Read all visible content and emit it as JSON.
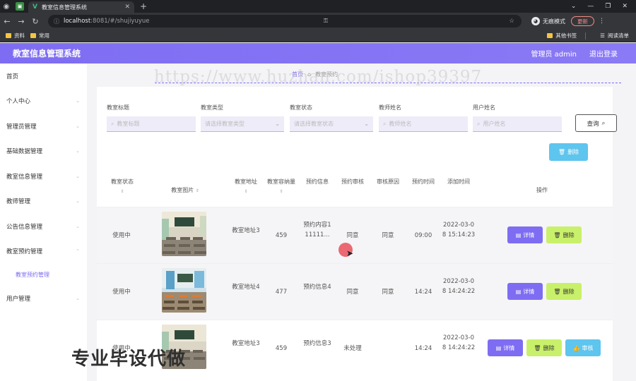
{
  "browser": {
    "tab_title": "教室信息管理系统",
    "url_host": "localhost",
    "url_path": ":8081/#/shujiyuyue",
    "incognito_label": "无痕模式",
    "update_label": "更新",
    "bookmarks": [
      "资料",
      "常用"
    ],
    "bookmarks_right": [
      "其他书签",
      "阅读清单"
    ]
  },
  "header": {
    "title": "教室信息管理系统",
    "user": "管理员 admin",
    "logout": "退出登录"
  },
  "sidebar": {
    "items": [
      {
        "label": "首页"
      },
      {
        "label": "个人中心"
      },
      {
        "label": "管理员管理"
      },
      {
        "label": "基础数据管理"
      },
      {
        "label": "教室信息管理"
      },
      {
        "label": "教师管理"
      },
      {
        "label": "公告信息管理"
      },
      {
        "label": "教室预约管理"
      }
    ],
    "active_sub": "教室预约管理",
    "last_item": "用户管理"
  },
  "breadcrumb": {
    "home": "首页",
    "current": "教室预约"
  },
  "filters": {
    "labels": [
      "教室标题",
      "教室类型",
      "教室状态",
      "教师姓名",
      "用户姓名"
    ],
    "placeholders": [
      "教室标题",
      "请选择教室类型",
      "请选择教室状态",
      "教师姓名",
      "用户姓名"
    ],
    "query_button": "查询"
  },
  "toolbar": {
    "delete_label": "删除"
  },
  "table": {
    "headers": [
      "教室状态",
      "教室图片",
      "教室地址",
      "教室容纳量",
      "预约信息",
      "预约审核",
      "审核原因",
      "预约时间",
      "添加时间",
      "操作"
    ],
    "rows": [
      {
        "status": "使用中",
        "address": "教室地址3",
        "capacity": "459",
        "info": "预约内容111111...",
        "audit": "同意",
        "reason": "同意",
        "time": "09:00",
        "added": "2022-03-08 15:14:23"
      },
      {
        "status": "使用中",
        "address": "教室地址4",
        "capacity": "477",
        "info": "预约信息4",
        "audit": "同意",
        "reason": "同意",
        "time": "14:24",
        "added": "2022-03-08 14:24:22"
      },
      {
        "status": "使用中",
        "address": "教室地址3",
        "capacity": "459",
        "info": "预约信息3",
        "audit": "未处理",
        "reason": "",
        "time": "14:24",
        "added": "2022-03-08 14:24:22"
      }
    ],
    "actions": {
      "detail": "详情",
      "delete": "删除",
      "review": "审核"
    }
  },
  "watermarks": {
    "url": "https://www.huzhan.com/ishop39397",
    "cn": "专业毕设代做"
  }
}
